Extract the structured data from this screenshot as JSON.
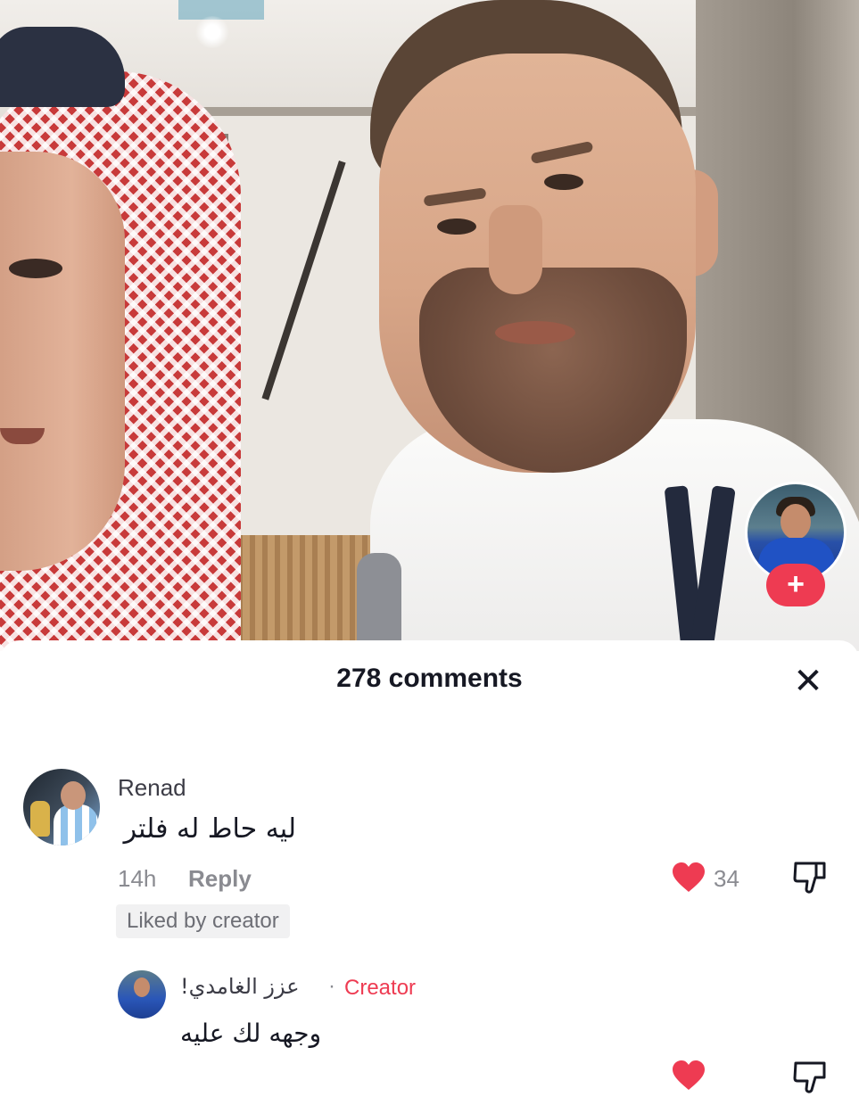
{
  "video": {
    "creator_avatar_icon": "creator-avatar",
    "follow_label": "+"
  },
  "comments_panel": {
    "title": "278 comments",
    "close_label": "✕"
  },
  "comments": [
    {
      "username": "Renad",
      "text": "ليه حاط له فلتر",
      "time": "14h",
      "reply_label": "Reply",
      "like_count": "34",
      "liked": true,
      "badge": "Liked by creator"
    }
  ],
  "replies": [
    {
      "username": "عزز الغامدي!",
      "separator": "·",
      "tag": "Creator",
      "text": "وجهه لك عليه"
    }
  ],
  "colors": {
    "accent": "#ee3b52",
    "text_primary": "#161823",
    "text_secondary": "#8a8b91"
  }
}
